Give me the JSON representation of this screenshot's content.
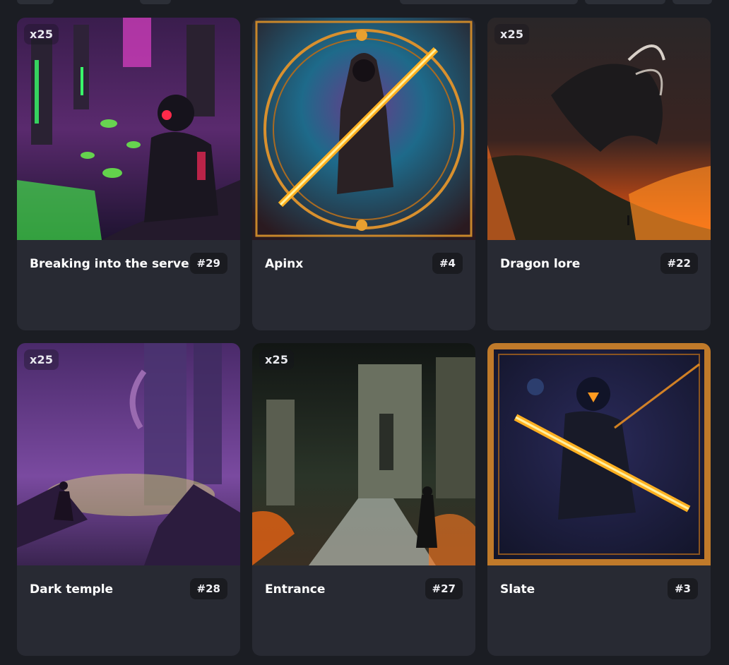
{
  "cards": [
    {
      "title": "Breaking into the server",
      "number": "#29",
      "edition": "x25"
    },
    {
      "title": "Apinx",
      "number": "#4",
      "edition": ""
    },
    {
      "title": "Dragon lore",
      "number": "#22",
      "edition": "x25"
    },
    {
      "title": "Dark temple",
      "number": "#28",
      "edition": "x25"
    },
    {
      "title": "Entrance",
      "number": "#27",
      "edition": "x25"
    },
    {
      "title": "Slate",
      "number": "#3",
      "edition": ""
    }
  ],
  "colors": {
    "background": "#1b1d23",
    "card": "#282a33",
    "badge": "#1a1b20"
  }
}
